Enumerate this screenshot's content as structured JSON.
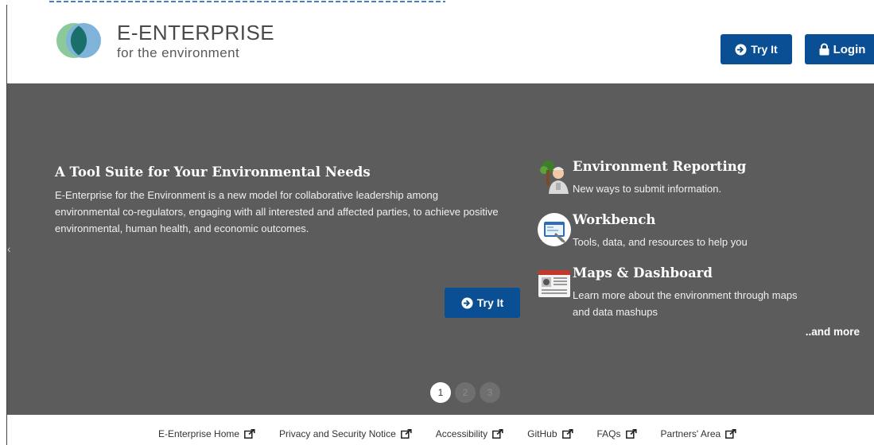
{
  "brand": {
    "line1": "E-ENTERPRISE",
    "line2": "for the environment"
  },
  "header": {
    "try_label": "Try It",
    "login_label": "Login"
  },
  "hero": {
    "title": "A Tool Suite for Your Environmental Needs",
    "description": "E-Enterprise for the Environment is a new model for collaborative leadership among environmental co-regulators, engaging with all interested and affected parties, to achieve positive environmental, human health, and economic outcomes.",
    "try_label": "Try It",
    "features": [
      {
        "title": "Environment Reporting",
        "desc": "New ways to submit information.",
        "icon": "reporting-person-icon"
      },
      {
        "title": "Workbench",
        "desc": "Tools, data, and resources to help you",
        "icon": "workbench-tools-icon"
      },
      {
        "title": "Maps & Dashboard",
        "desc": "Learn more about the environment through maps and data mashups",
        "icon": "newspaper-map-icon"
      }
    ],
    "and_more": "..and more",
    "pages": [
      "1",
      "2",
      "3"
    ],
    "active_page": "1"
  },
  "footer": {
    "links": [
      "E-Enterprise Home",
      "Privacy and Security Notice",
      "Accessibility",
      "GitHub",
      "FAQs",
      "Partners' Area"
    ]
  },
  "colors": {
    "accent": "#0a4f93",
    "hero_bg": "#5c5c5c",
    "logo_green": "#8cc99a",
    "logo_blue": "#7fb3d9",
    "logo_teal": "#1a6f6a"
  }
}
